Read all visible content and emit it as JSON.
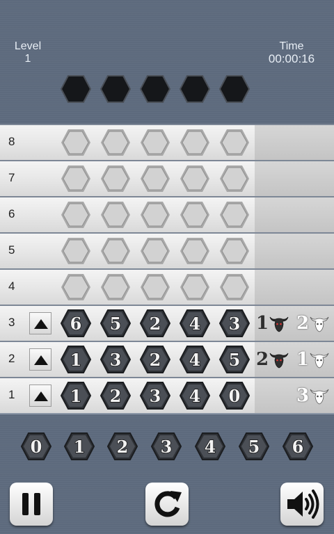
{
  "hud": {
    "level_label": "Level",
    "level_value": "1",
    "time_label": "Time",
    "time_value": "00:00:16"
  },
  "secret": {
    "slots": 5,
    "hidden": true
  },
  "rows": [
    {
      "number": "8",
      "state": "empty",
      "digits": [],
      "bulls": null,
      "cows": null
    },
    {
      "number": "7",
      "state": "empty",
      "digits": [],
      "bulls": null,
      "cows": null
    },
    {
      "number": "6",
      "state": "empty",
      "digits": [],
      "bulls": null,
      "cows": null
    },
    {
      "number": "5",
      "state": "empty",
      "digits": [],
      "bulls": null,
      "cows": null
    },
    {
      "number": "4",
      "state": "empty",
      "digits": [],
      "bulls": null,
      "cows": null
    },
    {
      "number": "3",
      "state": "guess",
      "digits": [
        "6",
        "5",
        "2",
        "4",
        "3"
      ],
      "bulls": "1",
      "cows": "2"
    },
    {
      "number": "2",
      "state": "guess",
      "digits": [
        "1",
        "3",
        "2",
        "4",
        "5"
      ],
      "bulls": "2",
      "cows": "1"
    },
    {
      "number": "1",
      "state": "guess",
      "digits": [
        "1",
        "2",
        "3",
        "4",
        "0"
      ],
      "bulls": null,
      "cows": "3"
    }
  ],
  "keypad": {
    "digits": [
      "0",
      "1",
      "2",
      "3",
      "4",
      "5",
      "6"
    ]
  },
  "controls": {
    "pause_icon": "pause-icon",
    "restart_icon": "restart-icon",
    "sound_icon": "speaker-icon"
  },
  "colors": {
    "background": "#5d6a7d",
    "hex_dark": "#3a3d42",
    "hex_empty": "#c8c8c8"
  }
}
